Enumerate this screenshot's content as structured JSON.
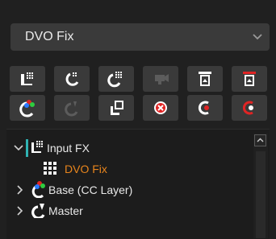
{
  "dropdown": {
    "selected": "DVO Fix"
  },
  "toolbar": {
    "row1": [
      {
        "name": "add-node-icon",
        "state": "enabled"
      },
      {
        "name": "add-node-alt-icon",
        "state": "enabled"
      },
      {
        "name": "add-grid-node-icon",
        "state": "enabled"
      },
      {
        "name": "camera-icon",
        "state": "disabled"
      },
      {
        "name": "layer-top-icon",
        "state": "enabled"
      },
      {
        "name": "layer-top-red-icon",
        "state": "enabled"
      }
    ],
    "row2": [
      {
        "name": "color-layer-icon",
        "state": "enabled"
      },
      {
        "name": "master-disabled-icon",
        "state": "disabled"
      },
      {
        "name": "node-connect-icon",
        "state": "enabled"
      },
      {
        "name": "remove-circle-icon",
        "state": "enabled"
      },
      {
        "name": "record-left-icon",
        "state": "enabled"
      },
      {
        "name": "record-red-icon",
        "state": "enabled"
      }
    ]
  },
  "tree": {
    "items": [
      {
        "label": "Input FX",
        "expanded": true,
        "level": 0
      },
      {
        "label": "DVO Fix",
        "selected": true,
        "level": 1
      },
      {
        "label": "Base (CC Layer)",
        "expanded": false,
        "level": 0
      },
      {
        "label": "Master",
        "expanded": false,
        "level": 0
      }
    ]
  },
  "colors": {
    "accent": "#e8851d",
    "bg": "#202020",
    "button": "#3a3a3a",
    "teal": "#2fb3b3",
    "red": "#e02424"
  }
}
